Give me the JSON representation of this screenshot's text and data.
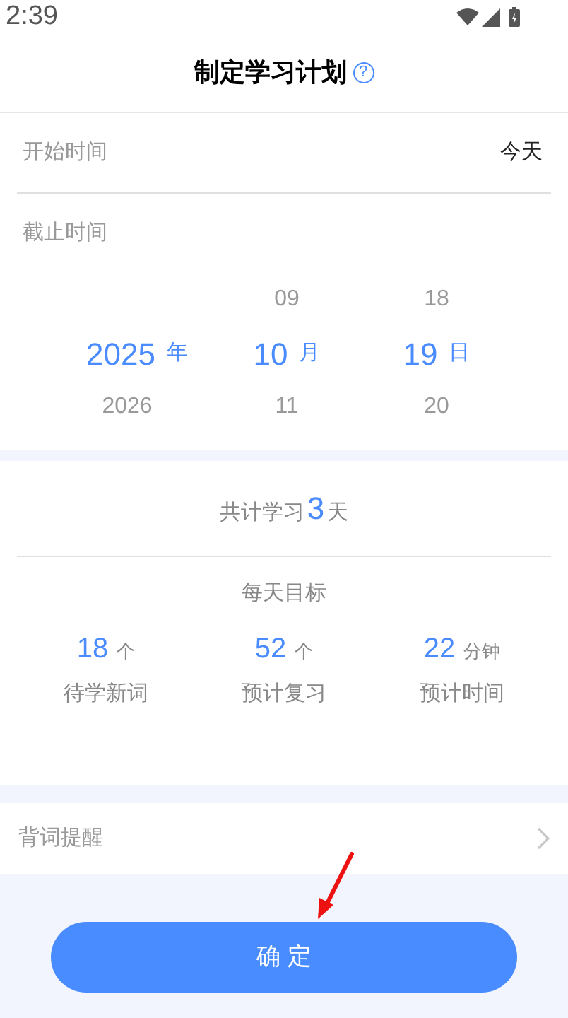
{
  "status_bar": {
    "time": "2:39"
  },
  "header": {
    "title": "制定学习计划",
    "help_icon": "?"
  },
  "start_time": {
    "label": "开始时间",
    "value": "今天"
  },
  "end_time": {
    "label": "截止时间",
    "picker": [
      {
        "unit": "年",
        "items": [
          {
            "value": "2025",
            "selected": true
          },
          {
            "value": "2026",
            "selected": false
          }
        ]
      },
      {
        "unit": "月",
        "items": [
          {
            "value": "09",
            "selected": false
          },
          {
            "value": "10",
            "selected": true
          },
          {
            "value": "11",
            "selected": false
          }
        ]
      },
      {
        "unit": "日",
        "items": [
          {
            "value": "18",
            "selected": false
          },
          {
            "value": "19",
            "selected": true
          },
          {
            "value": "20",
            "selected": false
          }
        ]
      }
    ]
  },
  "summary": {
    "prefix": "共计学习",
    "days": "3",
    "suffix": "天"
  },
  "daily_goal": {
    "title": "每天目标",
    "stats": [
      {
        "value": "18",
        "unit": "个",
        "label": "待学新词"
      },
      {
        "value": "52",
        "unit": "个",
        "label": "预计复习"
      },
      {
        "value": "22",
        "unit": "分钟",
        "label": "预计时间"
      }
    ]
  },
  "reminder": {
    "label": "背词提醒"
  },
  "confirm_button": "确 定"
}
